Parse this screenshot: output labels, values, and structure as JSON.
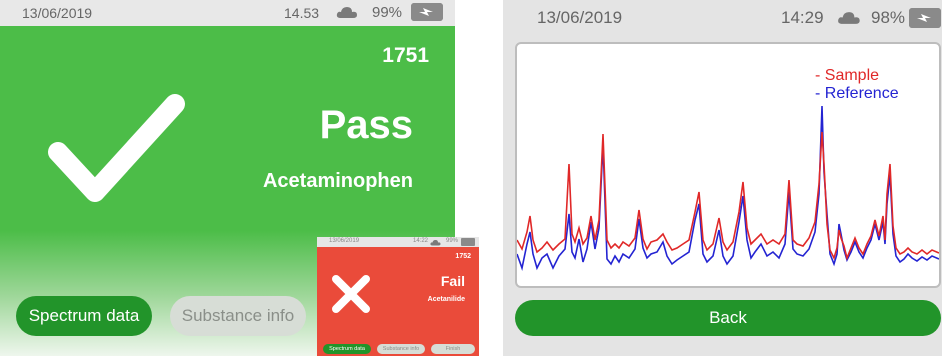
{
  "pass_screen": {
    "status": {
      "date": "13/06/2019",
      "time": "14.53",
      "battery": "99%"
    },
    "id_number": "1751",
    "result": "Pass",
    "substance": "Acetaminophen",
    "buttons": {
      "spectrum": "Spectrum data",
      "substance_info": "Substance info"
    }
  },
  "fail_screen": {
    "status": {
      "date": "13/06/2019",
      "time": "14:22",
      "battery": "99%"
    },
    "id_number": "1752",
    "result": "Fail",
    "substance": "Acetanilide",
    "buttons": {
      "spectrum": "Spectrum data",
      "substance_info": "Substance info",
      "finish": "Finish"
    }
  },
  "spectrum_screen": {
    "status": {
      "date": "13/06/2019",
      "time": "14:29",
      "battery": "98%"
    },
    "legend": {
      "sample": "- Sample",
      "reference": "- Reference"
    },
    "back_label": "Back"
  },
  "colors": {
    "pass_green": "#4cbd48",
    "fail_red": "#ea4b3a",
    "button_green": "#22942a",
    "sample_line": "#e02828",
    "reference_line": "#2424d2"
  },
  "icons": {
    "status": [
      "cloud-icon",
      "plug-icon"
    ],
    "pass": "checkmark-icon",
    "fail": "x-icon"
  }
}
